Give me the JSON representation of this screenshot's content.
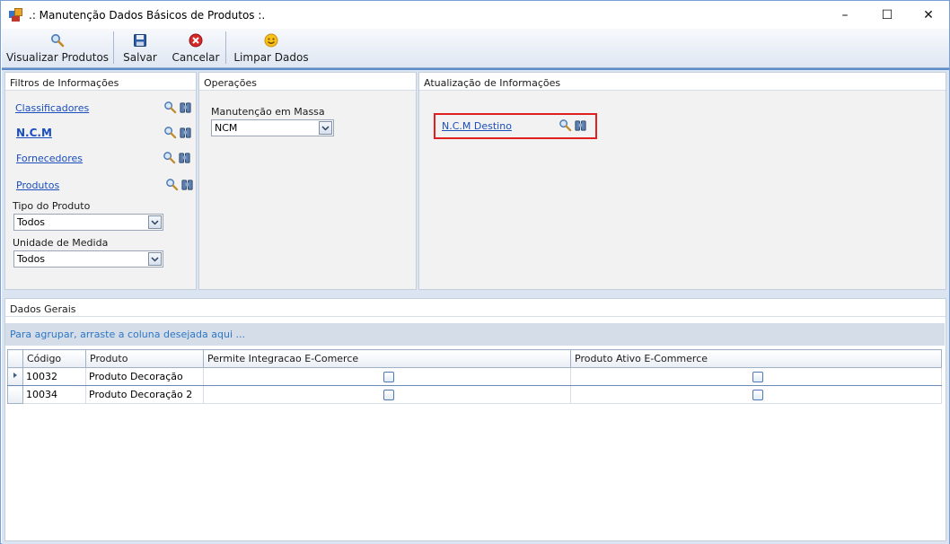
{
  "window": {
    "title": ".: Manutenção Dados Básicos de Produtos :.",
    "minimize_label": "–",
    "maximize_label": "☐",
    "close_label": "✕"
  },
  "toolbar": {
    "view_label": "Visualizar Produtos",
    "save_label": "Salvar",
    "cancel_label": "Cancelar",
    "clear_label": "Limpar Dados"
  },
  "filters": {
    "title": "Filtros de Informações",
    "classificadores": "Classificadores",
    "ncm": "N.C.M",
    "fornecedores": "Fornecedores",
    "produtos": "Produtos",
    "tipo_label": "Tipo do Produto",
    "tipo_value": "Todos",
    "unidade_label": "Unidade de Medida",
    "unidade_value": "Todos"
  },
  "operations": {
    "title": "Operações",
    "manutencao_label": "Manutenção em Massa",
    "manutencao_value": "NCM"
  },
  "updates": {
    "title": "Atualização de Informações",
    "ncm_destino": "N.C.M Destino"
  },
  "general": {
    "title": "Dados Gerais",
    "group_hint": "Para agrupar, arraste a coluna desejada aqui ...",
    "columns": [
      "Código",
      "Produto",
      "Permite Integracao E-Comerce",
      "Produto Ativo E-Commerce"
    ],
    "rows": [
      {
        "codigo": "10032",
        "produto": "Produto Decoração",
        "integracao": false,
        "ativo": false
      },
      {
        "codigo": "10034",
        "produto": "Produto Decoração 2",
        "integracao": false,
        "ativo": false
      }
    ]
  },
  "colors": {
    "link": "#1a4dbd",
    "highlight_border": "#e02020",
    "group_hint": "#2f77c6"
  }
}
